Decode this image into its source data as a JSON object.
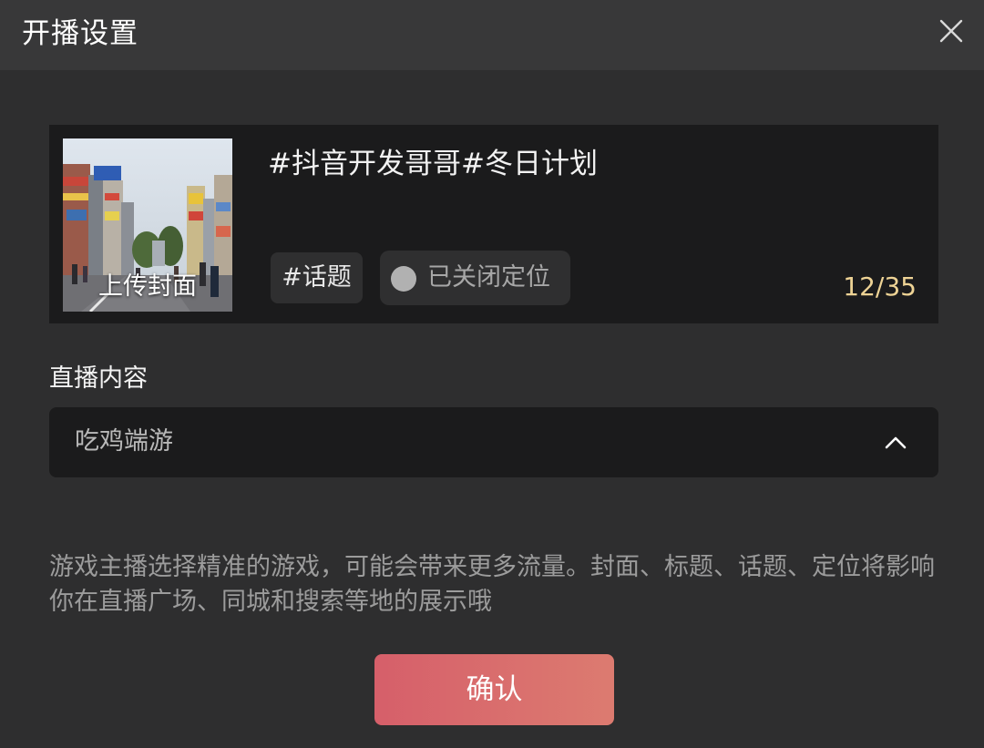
{
  "window": {
    "title": "开播设置",
    "close_icon": "close-icon"
  },
  "card": {
    "cover_label": "上传封面",
    "live_title": "#抖音开发哥哥#冬日计划",
    "topic_chip": "#话题",
    "location_chip": "已关闭定位",
    "char_counter": "12/35",
    "counter_color": "#eed395"
  },
  "content": {
    "label": "直播内容",
    "selected": "吃鸡端游",
    "chevron_icon": "chevron-up-icon"
  },
  "hint_text": "游戏主播选择精准的游戏，可能会带来更多流量。封面、标题、话题、定位将影响你在直播广场、同城和搜索等地的展示哦",
  "confirm_button": {
    "label": "确认",
    "gradient": [
      "#d65f6a",
      "#dc7b70"
    ]
  }
}
